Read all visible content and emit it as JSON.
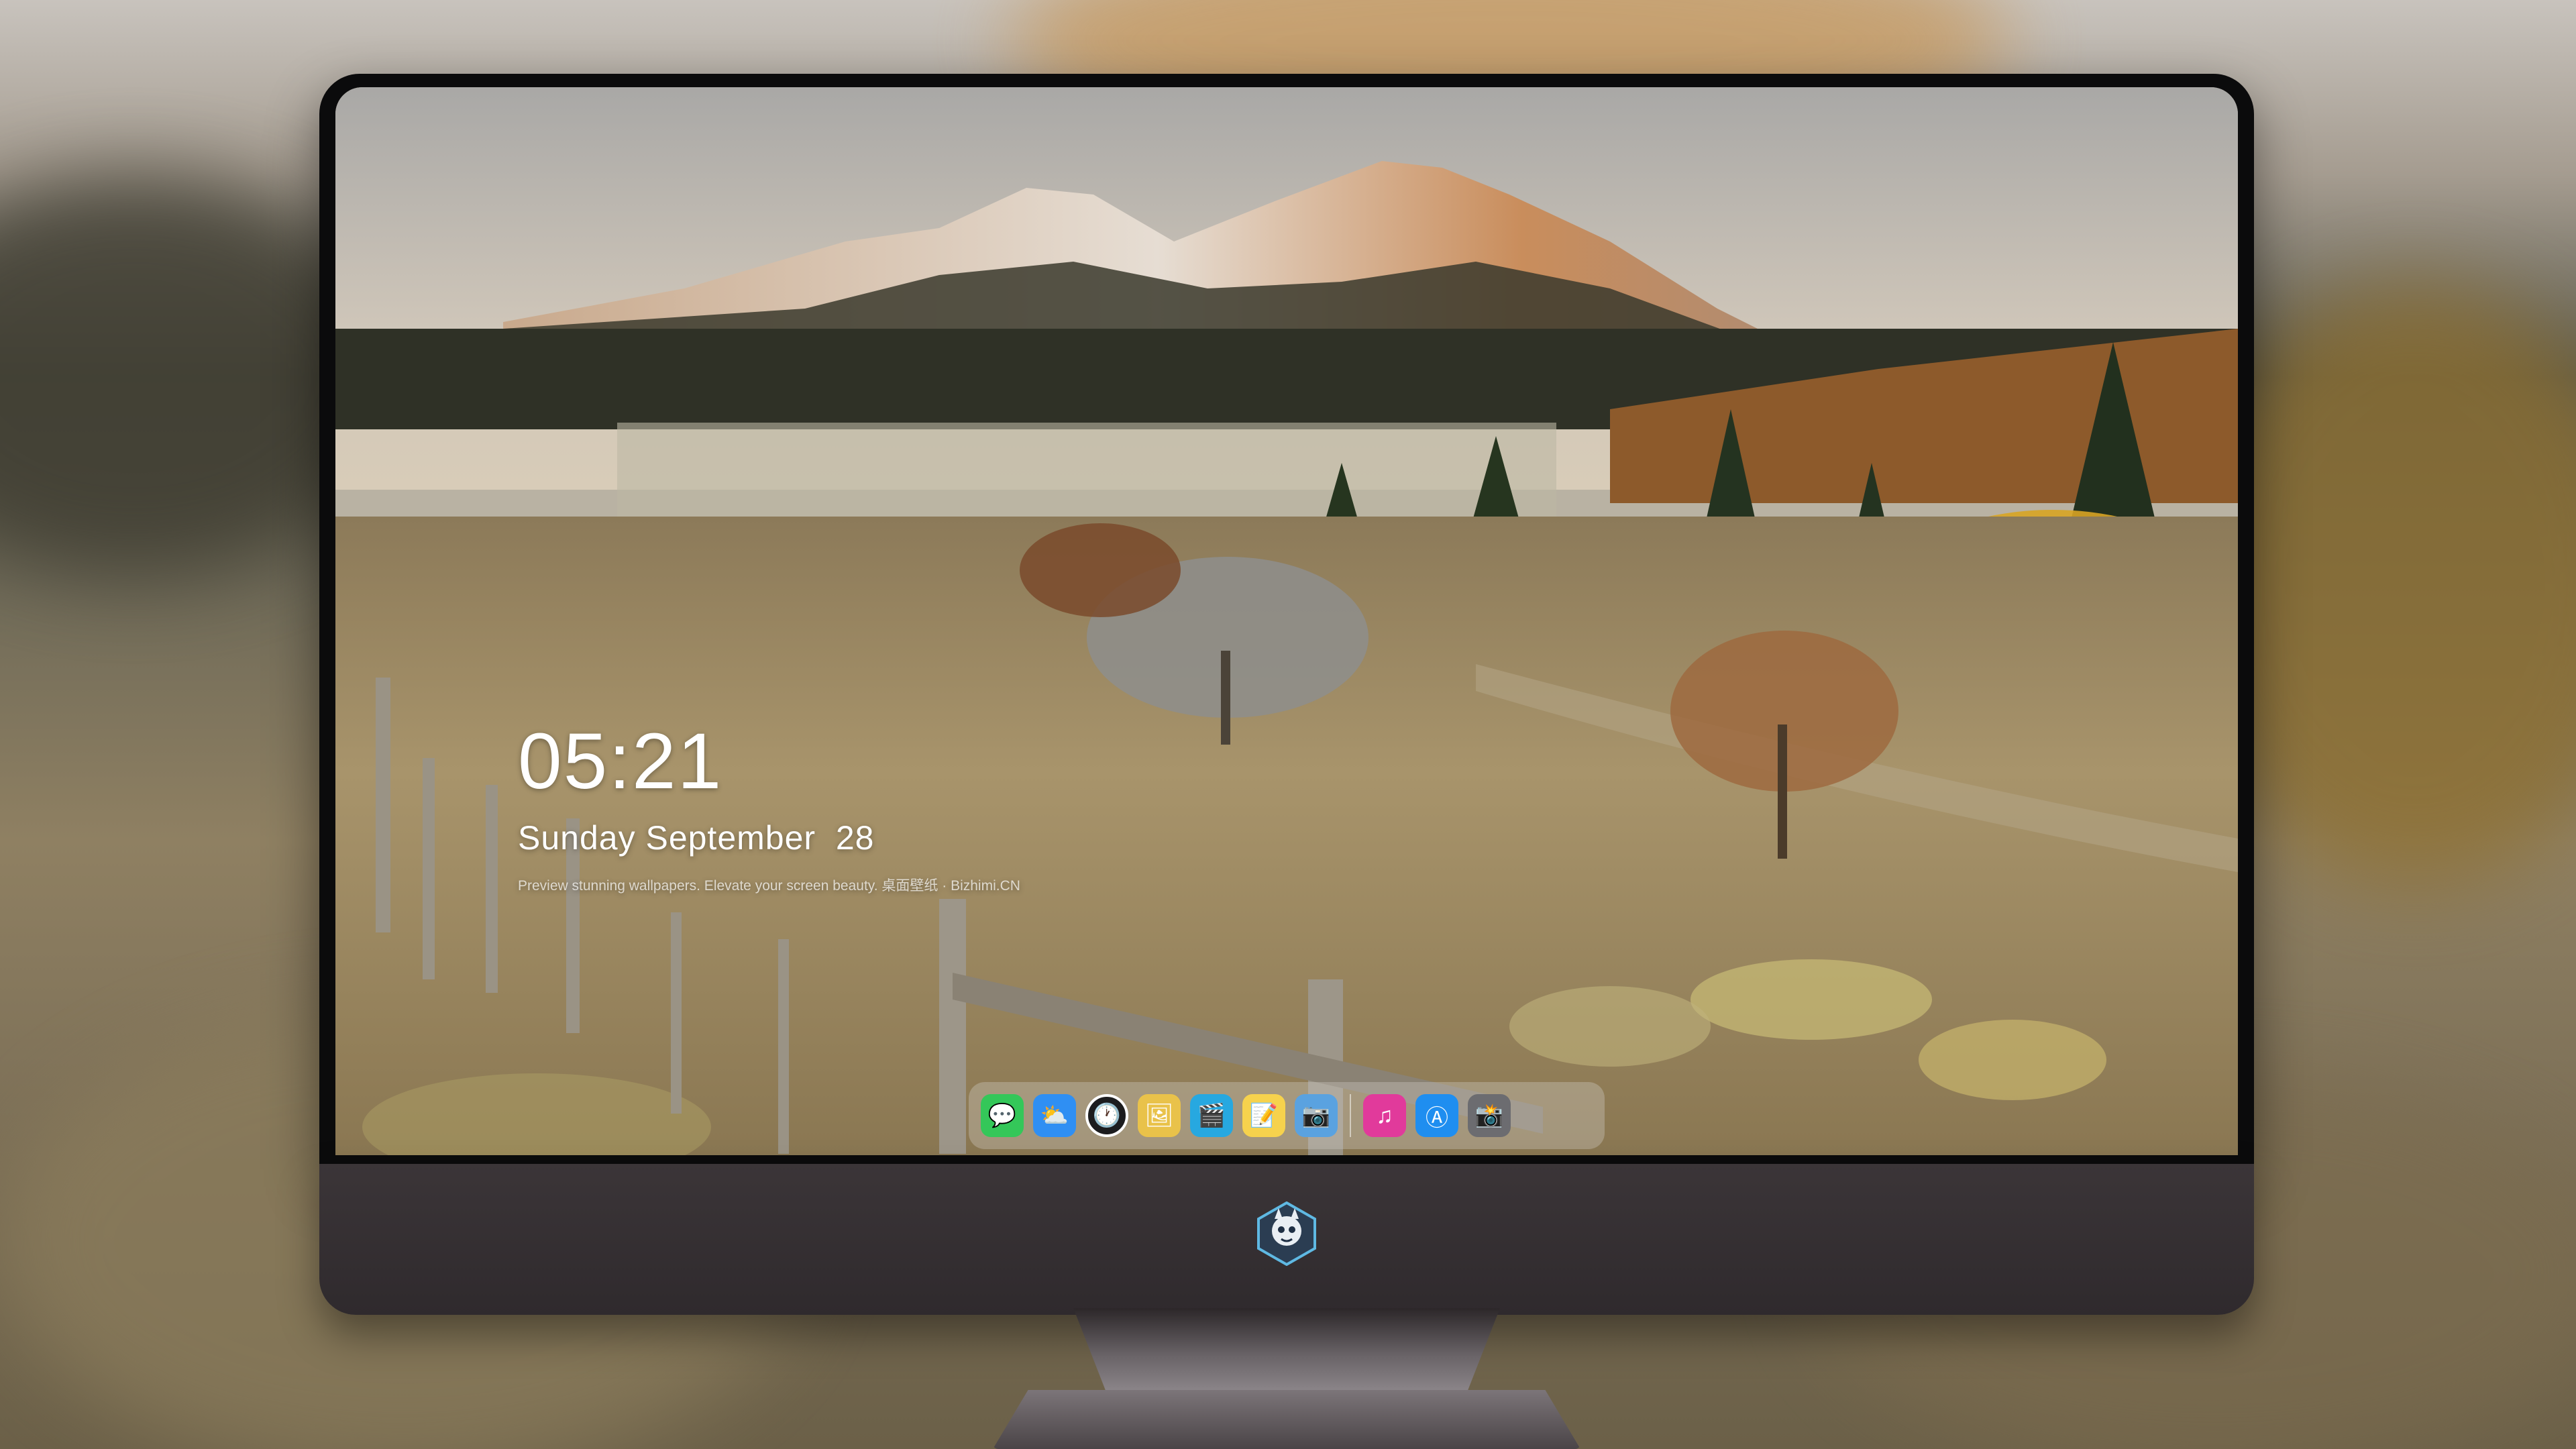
{
  "lockscreen": {
    "time": "05:21",
    "date": "Sunday September  28",
    "tagline": "Preview stunning wallpapers. Elevate your screen beauty. 桌面壁纸 · Bizhimi.CN"
  },
  "dock": {
    "apps": [
      {
        "name": "Messages",
        "icon": "messages-icon",
        "glyph": "💬",
        "color": "#34c759"
      },
      {
        "name": "Weather",
        "icon": "weather-icon",
        "glyph": "⛅",
        "color": "#2f8ff3"
      },
      {
        "name": "Clock",
        "icon": "clock-icon",
        "glyph": "🕐",
        "color": "#1c1c1e"
      },
      {
        "name": "Preview",
        "icon": "preview-icon",
        "glyph": "🖼",
        "color": "#e9c24a"
      },
      {
        "name": "Clips",
        "icon": "clips-icon",
        "glyph": "🎬",
        "color": "#27a8e0"
      },
      {
        "name": "Notes",
        "icon": "notes-icon",
        "glyph": "📝",
        "color": "#f6d24d"
      },
      {
        "name": "Photo Booth",
        "icon": "photo-booth-icon",
        "glyph": "📷",
        "color": "#5aa2e0"
      },
      {
        "name": "iTunes",
        "icon": "music-icon",
        "glyph": "♫",
        "color": "#e13a9b"
      },
      {
        "name": "App Store",
        "icon": "app-store-icon",
        "glyph": "Ⓐ",
        "color": "#1f8ef0"
      },
      {
        "name": "Camera",
        "icon": "camera-icon",
        "glyph": "📸",
        "color": "#6c6c70"
      }
    ]
  },
  "device": {
    "brand_logo": "mascot-logo-icon"
  }
}
